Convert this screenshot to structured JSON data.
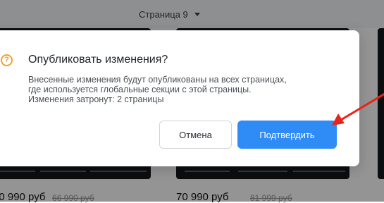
{
  "header": {
    "page_selector_label": "Страница 9"
  },
  "products": [
    {
      "price": "90 990 руб",
      "old_price": "66 990 руб"
    },
    {
      "price": "70 990 руб",
      "old_price": "81 999 руб"
    }
  ],
  "dialog": {
    "title": "Опубликовать изменения?",
    "body_lines": [
      "Внесенные изменения будут опубликованы на всех страницах,",
      "где используется глобальные секции с этой страницы.",
      "Изменения затронут: 2 страницы"
    ],
    "cancel_label": "Отмена",
    "confirm_label": "Подтвердить"
  },
  "colors": {
    "accent": "#2f8cf7",
    "warning": "#f2a22b",
    "annotation_arrow": "#e8231c"
  },
  "icons": {
    "question": "question-circle-icon",
    "caret": "chevron-down-icon"
  }
}
